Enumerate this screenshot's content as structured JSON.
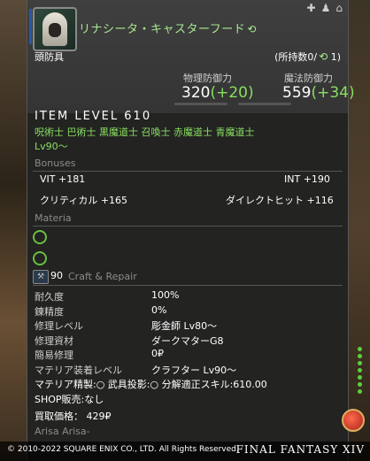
{
  "item": {
    "name": "リナシータ・キャスターフード",
    "hq_icon": "hq-icon",
    "category": "頭防具",
    "owned": "(所持数0/",
    "owned_hq": "1)",
    "top_icons": [
      "plus-icon",
      "dye-icon",
      "pin-icon"
    ]
  },
  "stats": {
    "physical_label": "物理防御力",
    "physical_value": "320",
    "physical_bonus": "(+20)",
    "magic_label": "魔法防御力",
    "magic_value": "559",
    "magic_bonus": "(+34)"
  },
  "item_level": "ITEM LEVEL 610",
  "jobs": "呪術士 巴術士 黒魔道士 召喚士 赤魔道士 青魔道士",
  "level": "Lv90～",
  "bonuses": {
    "title": "Bonuses",
    "rows": [
      {
        "left": "VIT +181",
        "right": "INT +190"
      },
      {
        "left": "クリティカル +165",
        "right": "ダイレクトヒット +116"
      }
    ]
  },
  "materia": {
    "title": "Materia",
    "slots": 2
  },
  "craft": {
    "level": "90",
    "title": "Craft & Repair",
    "rows": [
      {
        "label": "耐久度",
        "value": "100%"
      },
      {
        "label": "錬精度",
        "value": "0%"
      },
      {
        "label": "修理レベル",
        "value": "彫金師 Lv80～"
      },
      {
        "label": "修理資材",
        "value": "ダークマターG8"
      },
      {
        "label": "簡易修理",
        "value": "0₽"
      },
      {
        "label": "マテリア装着レベル",
        "value": "クラフター Lv90～"
      }
    ],
    "misc1": "マテリア精製:○   武具投影:○   分解適正スキル:610.00",
    "misc2": "SHOP販売:なし",
    "price_label": "買取価格：",
    "price_value": "429₽",
    "author": "Arisa Arisa-"
  },
  "footer": {
    "copyright": "© 2010-2022 SQUARE ENIX CO., LTD. All Rights Reserved.",
    "logo": "FINAL FANTASY XIV"
  },
  "colors": {
    "hq_green": "#a8e890",
    "bonus_green": "#88e060",
    "panel": "#222222"
  }
}
